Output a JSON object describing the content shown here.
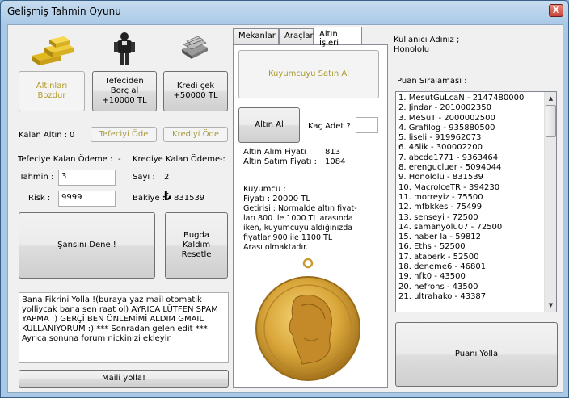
{
  "window": {
    "title": "Gelişmiş Tahmin Oyunu",
    "close": "X"
  },
  "left": {
    "btn_sell_gold": "Altınları\nBozdur",
    "btn_loan": "Tefeciden\nBorç al\n+10000 TL",
    "btn_credit": "Kredi çek\n+50000 TL",
    "remaining_gold_label": "Kalan Altın :",
    "remaining_gold_value": "0",
    "btn_pay_lender": "Tefeciyi Öde",
    "btn_pay_credit": "Krediyi Öde",
    "lender_payment_label": "Tefeciye Kalan Ödeme :",
    "lender_payment_value": "-",
    "credit_payment_label": "Krediye Kalan Ödeme :",
    "credit_payment_value": "-",
    "guess_label": "Tahmin :",
    "guess_value": "3",
    "number_label": "Sayı :",
    "number_value": "2",
    "risk_label": "Risk :",
    "risk_value": "9999",
    "balance_label": "Bakiye :",
    "balance_currency": "₺",
    "balance_value": "831539",
    "btn_try_luck": "Şansını Dene !",
    "btn_reset_today": "Bugda\nKaldım\nResetle",
    "feedback_text": "Bana Fikrini Yolla !(buraya yaz mail otomatik yolliycak bana sen raat ol) AYRICA LÜTFEN SPAM YAPMA :) GERÇİ BEN ÖNLEMİMİ ALDIM GMAIL KULLANIYORUM :) *** Sonradan gelen edit *** Ayrıca sonuna forum nickinizi ekleyin",
    "btn_send_mail": "Maili yolla!"
  },
  "middle": {
    "tabs": [
      {
        "label": "Mekanlar"
      },
      {
        "label": "Araçlar"
      },
      {
        "label": "Altın İşleri"
      }
    ],
    "btn_buy_jeweler": "Kuyumcuyu Satın Al",
    "btn_buy_gold": "Altın Al",
    "quantity_label": "Kaç Adet ?",
    "quantity_value": "",
    "buy_price_label": "Altın Alım Fiyatı :",
    "buy_price_value": "813",
    "sell_price_label": "Altın Satım Fiyatı :",
    "sell_price_value": "1084",
    "jeweler_title": "Kuyumcu :",
    "jeweler_price": "Fiyatı : 20000 TL",
    "jeweler_desc": "Getirisi : Normalde altın fiyat-\nları 800 ile 1000 TL arasında\niken, kuyumcuyu aldığınızda\nfiyatlar 900 ile 1100 TL\nArası olmaktadır."
  },
  "right": {
    "username_label": "Kullanıcı Adınız ;",
    "username_value": "Honololu",
    "scores_label": "Puan Sıralaması :",
    "scores": [
      "1. MesutGuLcaN - 2147480000",
      "2. Jindar - 2010002350",
      "3. MeSuT - 2000002500",
      "4. Grafilog - 935880500",
      "5. liseli - 919962073",
      "6. 46lik - 300002200",
      "7. abcde1771 - 9363464",
      "8. erengucluer - 5094044",
      "9. Honololu - 831539",
      "10. MacroIceTR - 394230",
      "11. morreyiz - 75500",
      "12. mfbkkes - 75499",
      "13. senseyi - 72500",
      "14. samanyolu07 - 72500",
      "15. naber la - 59812",
      "16. Eths - 52500",
      "17. ataberk - 52500",
      "18. deneme6 - 46801",
      "19. hfk0 - 43500",
      "20. nefrons - 43500",
      "21. ultrahako - 43387"
    ],
    "btn_send_score": "Puanı Yolla"
  }
}
